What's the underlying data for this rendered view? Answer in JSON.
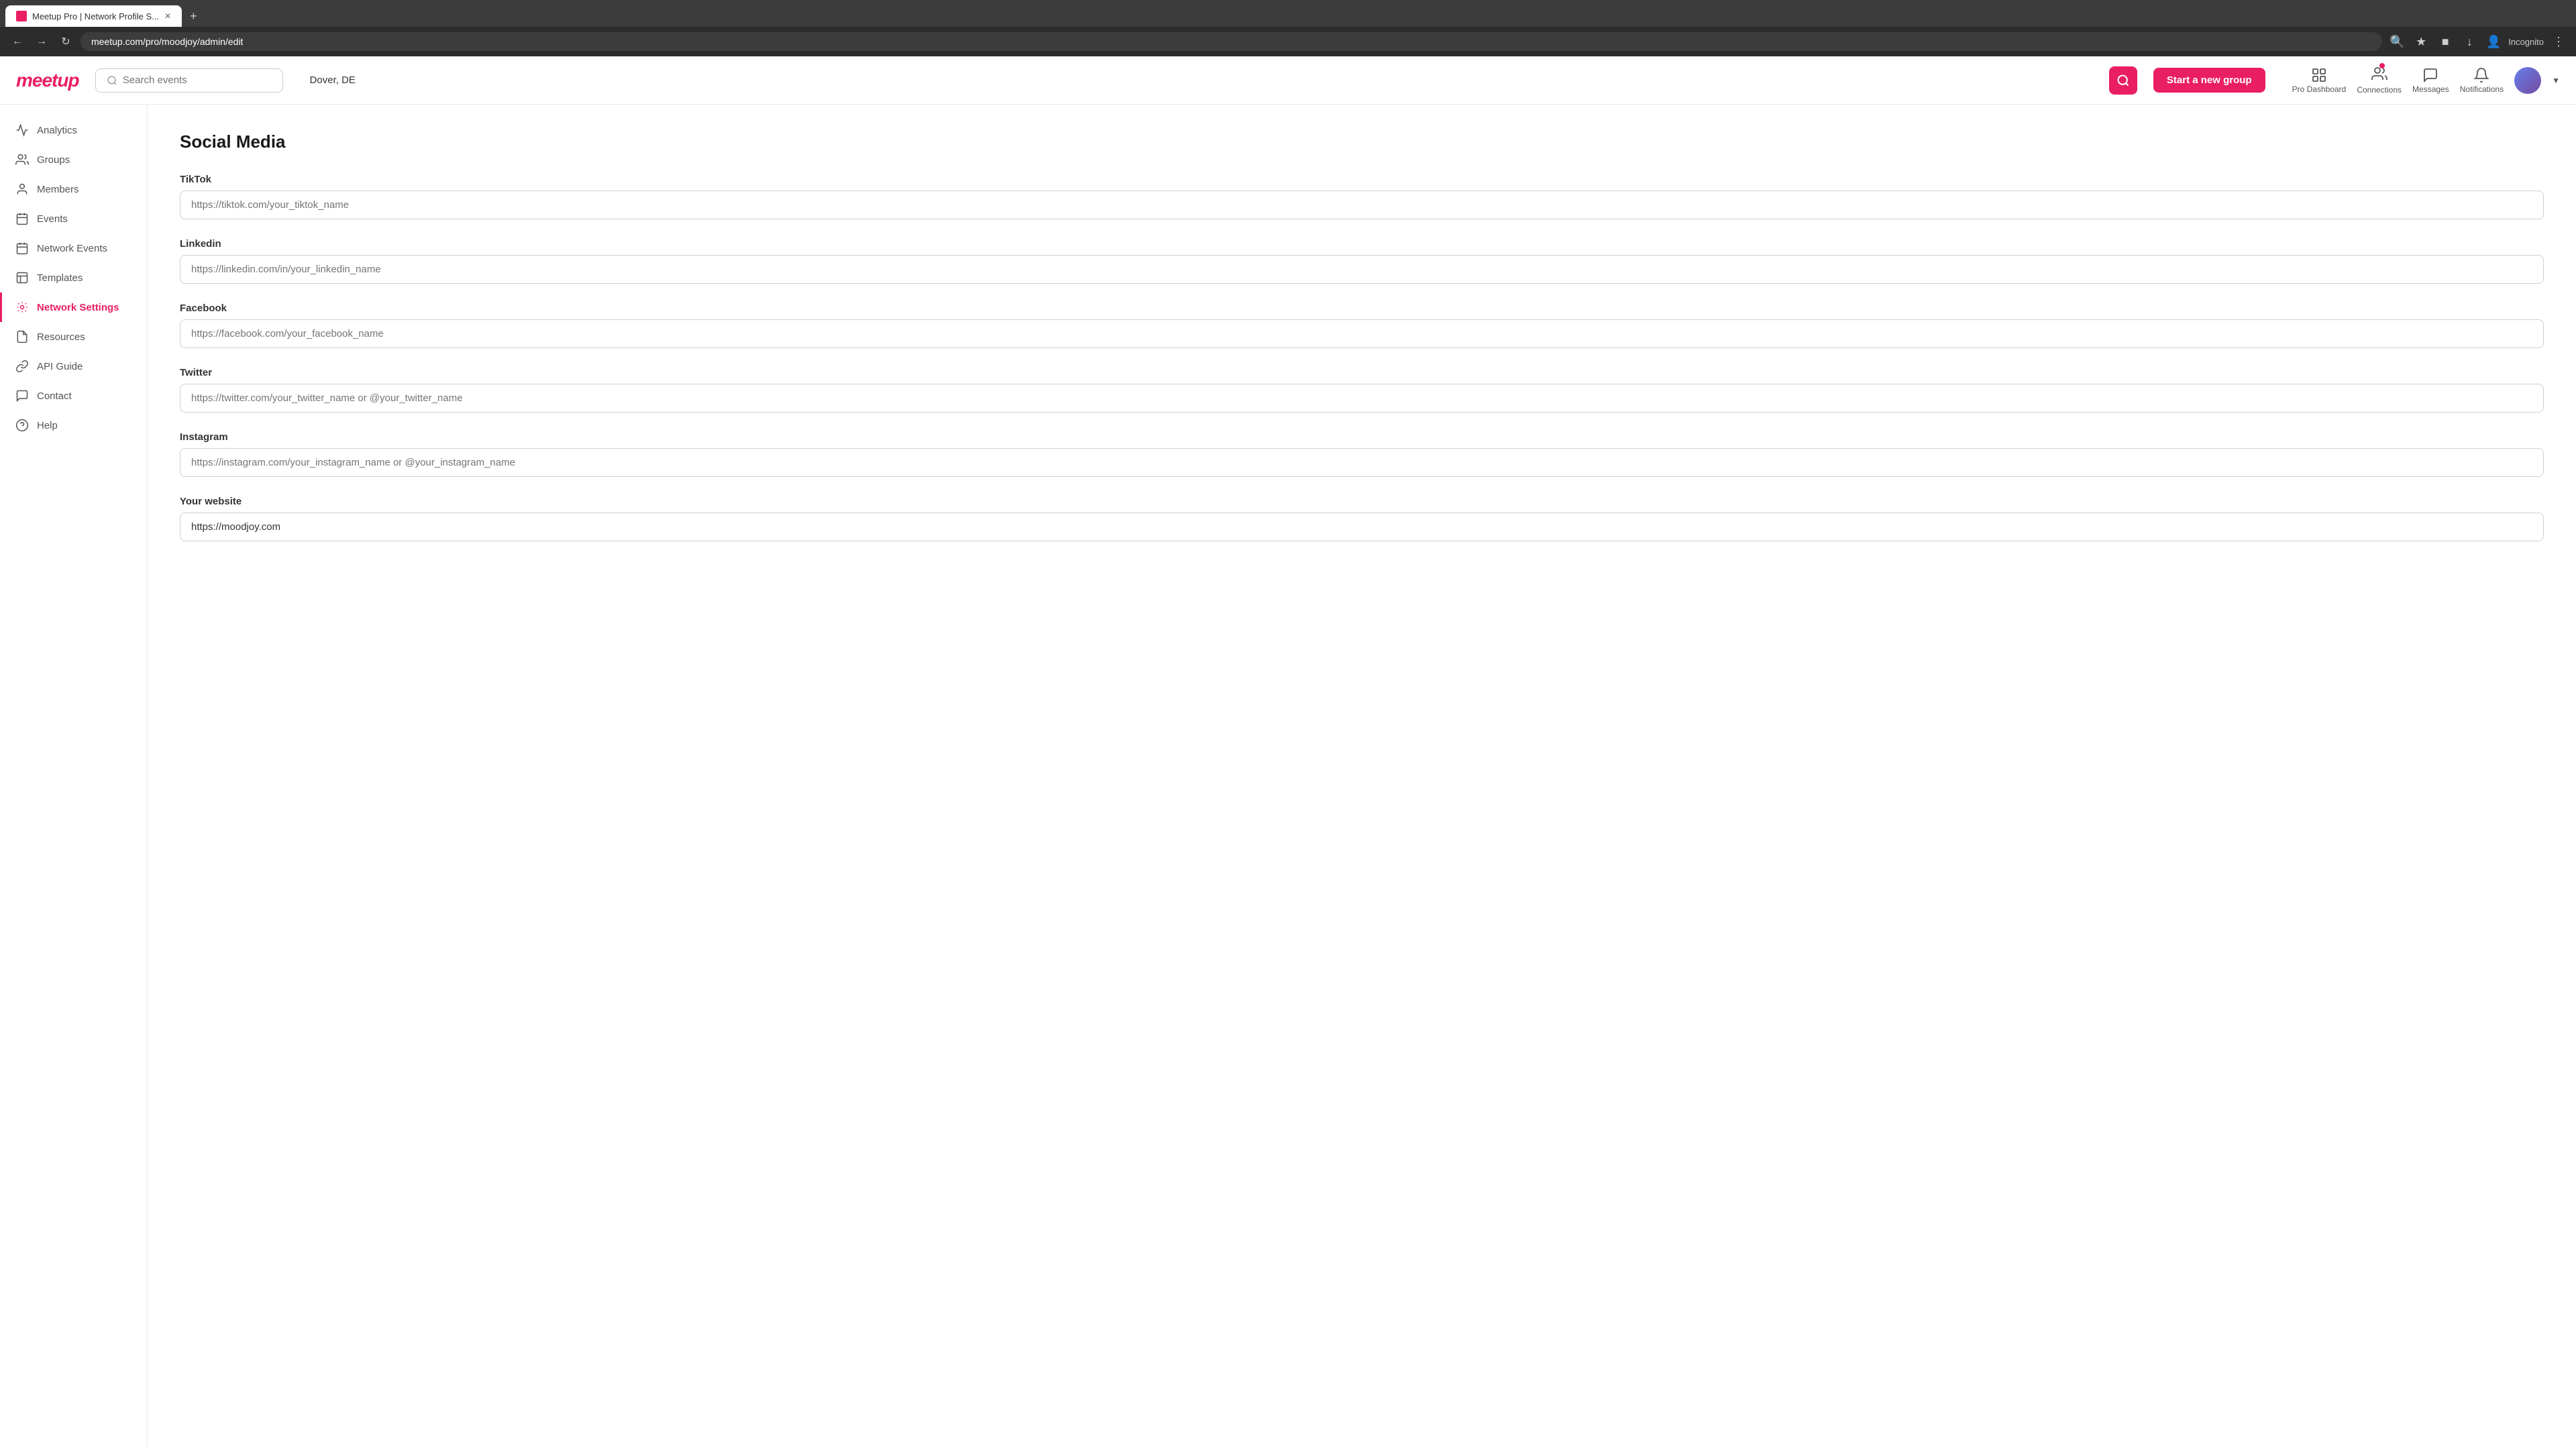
{
  "browser": {
    "tab_title": "Meetup Pro | Network Profile S...",
    "url": "meetup.com/pro/moodjoy/admin/edit",
    "new_tab_label": "+",
    "back_label": "←",
    "forward_label": "→",
    "reload_label": "↻",
    "incognito_label": "Incognito"
  },
  "topbar": {
    "logo": "meetup",
    "search_placeholder": "Search events",
    "location": "Dover, DE",
    "start_group_label": "Start a new group",
    "pro_dashboard_label": "Pro Dashboard",
    "connections_label": "Connections",
    "messages_label": "Messages",
    "notifications_label": "Notifications"
  },
  "sidebar": {
    "items": [
      {
        "id": "analytics",
        "label": "Analytics",
        "active": false
      },
      {
        "id": "groups",
        "label": "Groups",
        "active": false
      },
      {
        "id": "members",
        "label": "Members",
        "active": false
      },
      {
        "id": "events",
        "label": "Events",
        "active": false
      },
      {
        "id": "network-events",
        "label": "Network Events",
        "active": false
      },
      {
        "id": "templates",
        "label": "Templates",
        "active": false
      },
      {
        "id": "network-settings",
        "label": "Network Settings",
        "active": true
      },
      {
        "id": "resources",
        "label": "Resources",
        "active": false
      },
      {
        "id": "api-guide",
        "label": "API Guide",
        "active": false
      },
      {
        "id": "contact",
        "label": "Contact",
        "active": false
      },
      {
        "id": "help",
        "label": "Help",
        "active": false
      }
    ]
  },
  "main": {
    "section_title": "Social Media",
    "fields": [
      {
        "id": "tiktok",
        "label": "TikTok",
        "placeholder": "https://tiktok.com/your_tiktok_name",
        "value": ""
      },
      {
        "id": "linkedin",
        "label": "Linkedin",
        "placeholder": "https://linkedin.com/in/your_linkedin_name",
        "value": ""
      },
      {
        "id": "facebook",
        "label": "Facebook",
        "placeholder": "https://facebook.com/your_facebook_name",
        "value": ""
      },
      {
        "id": "twitter",
        "label": "Twitter",
        "placeholder": "https://twitter.com/your_twitter_name or @your_twitter_name",
        "value": ""
      },
      {
        "id": "instagram",
        "label": "Instagram",
        "placeholder": "https://instagram.com/your_instagram_name or @your_instagram_name",
        "value": ""
      },
      {
        "id": "website",
        "label": "Your website",
        "placeholder": "",
        "value": "https://moodjoy.com"
      }
    ]
  }
}
